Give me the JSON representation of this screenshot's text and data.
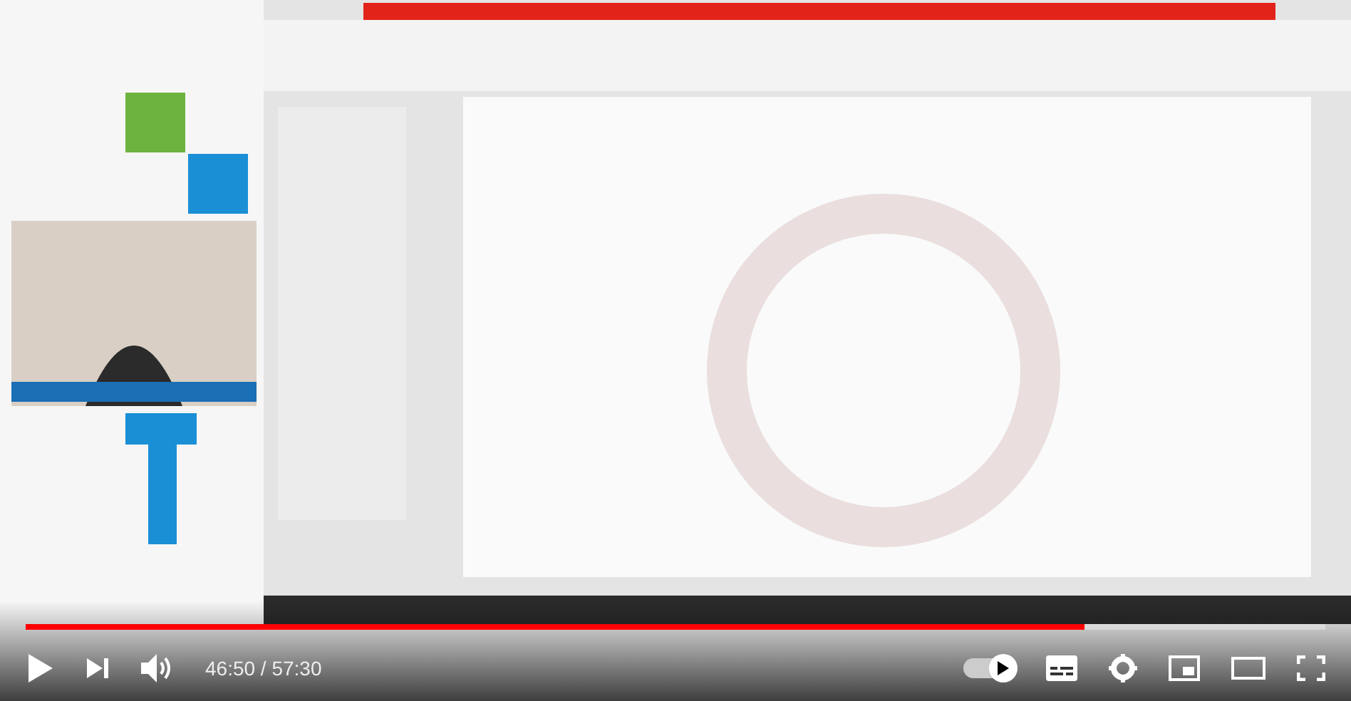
{
  "player": {
    "progress": {
      "level": 0.815
    },
    "time": "46:50 / 57:30",
    "autoplay": {
      "on": true
    }
  }
}
